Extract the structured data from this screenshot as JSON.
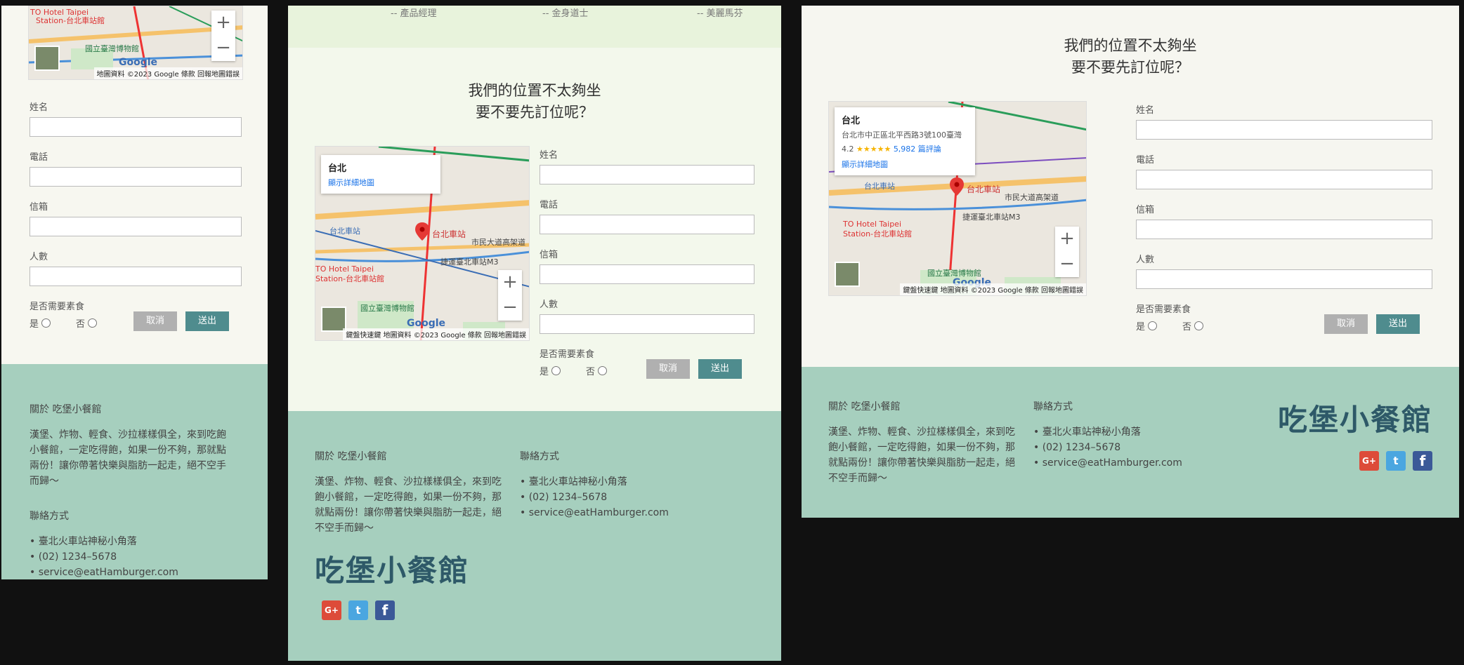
{
  "heading": {
    "line1": "我們的位置不太夠坐",
    "line2": "要不要先訂位呢？"
  },
  "testimonials": [
    "-- 產品經理",
    "-- 金身道士",
    "-- 美麗馬芬"
  ],
  "map": {
    "attribution": "地圖資料 ©2023 Google",
    "terms": "條款",
    "report": "回報地圖錯誤",
    "keyboard": "鍵盤快速鍵",
    "zoom_in": "+",
    "zoom_out": "−",
    "google": "Google",
    "place_title": "台北",
    "place_address": "台北市中正區北平西路3號100臺灣",
    "rating": "4.2",
    "stars": "★★★★★",
    "reviews": "5,982 篇評論",
    "detail_link": "顯示詳細地圖",
    "labels": {
      "station": "台北車站",
      "museum": "國立臺灣博物館",
      "hotel": "TO Hotel Taipei",
      "hotel_sub": "Station-台北車站館",
      "metro": "捷運臺北車站M3",
      "road": "市民大道高架道",
      "mrt": "台北車站"
    }
  },
  "form": {
    "name_label": "姓名",
    "phone_label": "電話",
    "email_label": "信箱",
    "people_label": "人數",
    "veg_label": "是否需要素食",
    "yes": "是",
    "no": "否",
    "cancel": "取消",
    "submit": "送出"
  },
  "footer": {
    "about_title": "關於 吃堡小餐館",
    "about_text": "漢堡、炸物、輕食、沙拉樣樣俱全，來到吃飽小餐館，一定吃得飽，如果一份不夠，那就點兩份！讓你帶著快樂與脂肪一起走，絕不空手而歸～",
    "contact_title": "聯絡方式",
    "contact": [
      "臺北火車站神秘小角落",
      "(02) 1234–5678",
      "service@eatHamburger.com"
    ],
    "brand": "吃堡小餐館"
  },
  "social": {
    "google": "G+",
    "twitter": "t",
    "facebook": "f"
  },
  "colors": {
    "footer_bg": "#a6cfbe",
    "submit_bg": "#4f8c8e",
    "brand": "#2e5968"
  }
}
